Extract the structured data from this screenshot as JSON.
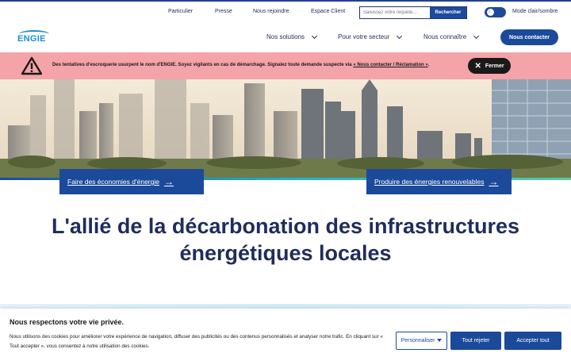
{
  "topbar": {
    "links": [
      "Particulier",
      "Presse",
      "Nous rejoindre",
      "Espace Client"
    ],
    "search_placeholder": "Saisissez votre requête...",
    "search_button": "Rechercher",
    "mode_label": "Mode clair/sombre"
  },
  "brand": {
    "logo_text": "ENGIE",
    "accent": "#1c4a9b",
    "logo_color": "#1b8fd1"
  },
  "nav": {
    "items": [
      "Nos solutions",
      "Pour votre secteur",
      "Nous connaître"
    ],
    "contact_button": "Nous contacter"
  },
  "alert": {
    "text": "Des tentatives d'escroquerie usurpent le nom d'ENGIE. Soyez vigilants en cas de démarchage. Signalez toute demande suspecte via ",
    "link": "« Nous contacter / Réclamation »",
    "text_end": ".",
    "close_label": "Fermer",
    "background": "#f4a3a8"
  },
  "hero": {
    "cta_left": "Faire des économies d'énergie",
    "cta_right": "Produire des énergies renouvelables"
  },
  "headline": {
    "line1": "L'allié de la décarbonation des infrastructures",
    "line2": "énergétiques locales"
  },
  "cookie": {
    "title": "Nous respectons votre vie privée.",
    "text": "Nous utilisons des cookies pour améliorer votre expérience de navigation, diffuser des publicités ou des contenus personnalisés et analyser notre trafic. En cliquant sur « Tout accepter », vous consentez à notre utilisation des cookies.",
    "customize": "Personnaliser",
    "reject": "Tout rejeter",
    "accept": "Accepter tout"
  }
}
